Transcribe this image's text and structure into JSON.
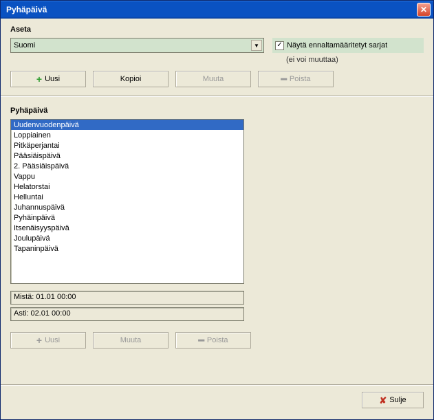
{
  "window": {
    "title": "Pyhäpäivä"
  },
  "aseta": {
    "label": "Aseta",
    "combo_value": "Suomi",
    "checkbox_label": "Näytä ennaltamääritetyt sarjat",
    "checkbox_checked": true,
    "checkbox_sub": "(ei voi muuttaa)"
  },
  "buttons_top": {
    "uusi": "Uusi",
    "kopioi": "Kopioi",
    "muuta": "Muuta",
    "poista": "Poista"
  },
  "list_section": {
    "label": "Pyhäpäivä",
    "items": [
      "Uudenvuodenpäivä",
      "Loppiainen",
      "Pitkäperjantai",
      "Pääsiäispäivä",
      "2. Pääsiäispäivä",
      "Vappu",
      "Helatorstai",
      "Helluntai",
      "Juhannuspäivä",
      "Pyhäinpäivä",
      "Itsenäisyyspäivä",
      "Joulupäivä",
      "Tapaninpäivä"
    ],
    "selected_index": 0
  },
  "fields": {
    "mista": "Mistä: 01.01  00:00",
    "asti": "Asti: 02.01  00:00"
  },
  "buttons_bottom": {
    "uusi": "Uusi",
    "muuta": "Muuta",
    "poista": "Poista"
  },
  "footer": {
    "sulje": "Sulje"
  }
}
